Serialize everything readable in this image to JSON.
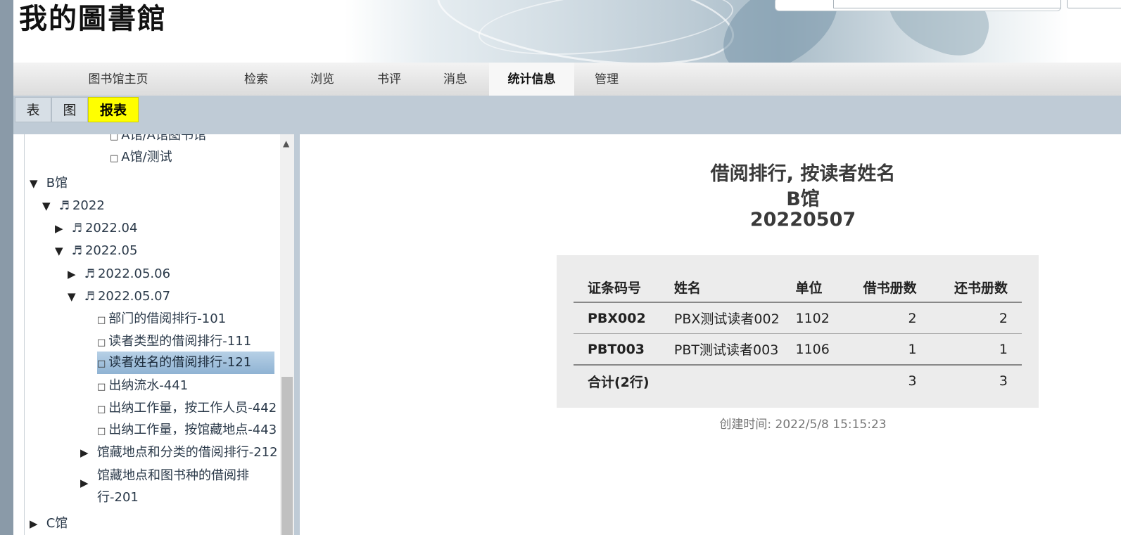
{
  "header": {
    "logo_text": "我的圖書館"
  },
  "nav": {
    "items": [
      {
        "label": "图书馆主页"
      },
      {
        "label": "检索"
      },
      {
        "label": "浏览"
      },
      {
        "label": "书评"
      },
      {
        "label": "消息"
      },
      {
        "label": "统计信息",
        "active": true
      },
      {
        "label": "管理"
      }
    ]
  },
  "subnav": {
    "tabs": [
      {
        "label": "表"
      },
      {
        "label": "图"
      },
      {
        "label": "报表",
        "active": true
      }
    ]
  },
  "tree": {
    "nodes": [
      {
        "label": "A馆/A馆图书馆",
        "kind": "leaf"
      },
      {
        "label": "A馆/测试",
        "kind": "leaf"
      },
      {
        "label": "B馆",
        "kind": "folder",
        "expanded": true
      },
      {
        "label": "2022",
        "kind": "year",
        "expanded": true
      },
      {
        "label": "2022.04",
        "kind": "month",
        "expanded": false
      },
      {
        "label": "2022.05",
        "kind": "month",
        "expanded": true
      },
      {
        "label": "2022.05.06",
        "kind": "day",
        "expanded": false
      },
      {
        "label": "2022.05.07",
        "kind": "day",
        "expanded": true
      },
      {
        "label": "部门的借阅排行-101",
        "kind": "leaf"
      },
      {
        "label": "读者类型的借阅排行-111",
        "kind": "leaf"
      },
      {
        "label": "读者姓名的借阅排行-121",
        "kind": "leaf",
        "selected": true
      },
      {
        "label": "出纳流水-441",
        "kind": "leaf"
      },
      {
        "label": "出纳工作量，按工作人员-442",
        "kind": "leaf"
      },
      {
        "label": "出纳工作量，按馆藏地点-443",
        "kind": "leaf"
      },
      {
        "label": "馆藏地点和分类的借阅排行-212",
        "kind": "folder",
        "expanded": false
      },
      {
        "label": "馆藏地点和图书种的借阅排",
        "kind": "folder",
        "expanded": false
      },
      {
        "label": "行-201",
        "kind": "continuation"
      },
      {
        "label": "C馆",
        "kind": "folder",
        "expanded": false
      }
    ],
    "glyphs": {
      "expanded": "▼",
      "collapsed": "▶",
      "note": "♬",
      "box": "□"
    }
  },
  "report": {
    "title_line1": "借阅排行, 按读者姓名",
    "title_line2": "B馆",
    "title_line3": "20220507",
    "columns": [
      "证条码号",
      "姓名",
      "单位",
      "借书册数",
      "还书册数"
    ],
    "rows": [
      [
        "PBX002",
        "PBX测试读者002",
        "1102",
        "2",
        "2"
      ],
      [
        "PBT003",
        "PBT测试读者003",
        "1106",
        "1",
        "1"
      ]
    ],
    "total": [
      "合计(2行)",
      "",
      "",
      "3",
      "3"
    ],
    "created": "创建时间: 2022/5/8 15:15:23"
  }
}
